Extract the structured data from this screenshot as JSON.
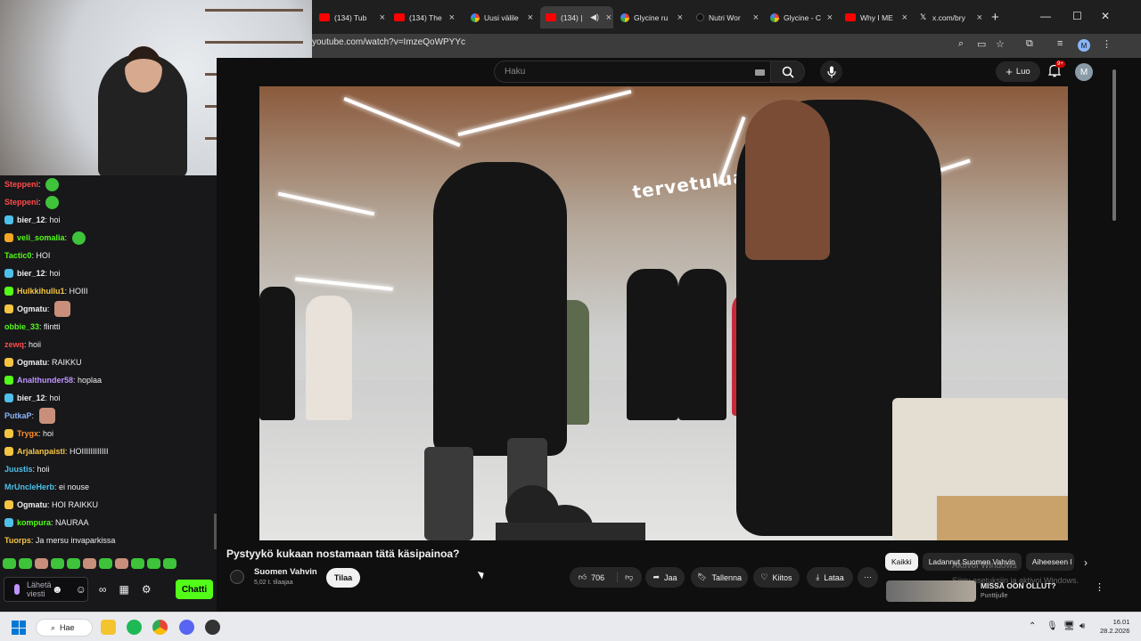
{
  "tabs": [
    {
      "label": "(134) Tub",
      "icon": "youtube"
    },
    {
      "label": "(134) The",
      "icon": "youtube"
    },
    {
      "label": "Uusi välile",
      "icon": "github"
    },
    {
      "label": "(134) |",
      "icon": "youtube",
      "active": true
    },
    {
      "label": "Glycine ru",
      "icon": "google"
    },
    {
      "label": "Nutri Wor",
      "icon": "site"
    },
    {
      "label": "Glycine - C",
      "icon": "google"
    },
    {
      "label": "Why I ME",
      "icon": "youtube"
    },
    {
      "label": "x.com/bry",
      "icon": "x"
    }
  ],
  "address": "youtube.com/watch?v=ImzeQoWPYYc",
  "profile_initial": "M",
  "youtube": {
    "search_placeholder": "Haku",
    "create_label": "Luo",
    "notif_count": "9+",
    "avatar_initial": "M"
  },
  "video": {
    "sign_text": "tervetulua",
    "title": "Pystyykö kukaan nostamaan tätä käsipainoa?",
    "channel": "Suomen Vahvin",
    "subs": "5,02 t. tilaajaa",
    "subscribe_label": "Tilaa",
    "likes": "706",
    "share_label": "Jaa",
    "save_label": "Tallenna",
    "thanks_label": "Kiitos",
    "download_label": "Lataa"
  },
  "chips": [
    "Kaikki",
    "Ladannut Suomen Vahvin",
    "Aiheeseen l"
  ],
  "recommended": {
    "title": "MISSÄ OON OLLUT?",
    "channel": "Punttijulle"
  },
  "activate_windows": [
    "Aktivoi Windows",
    "Siirry asetuksiin ja aktivoi Windows."
  ],
  "chat": {
    "messages": [
      {
        "user": "Steppeni",
        "color": "#ff4a4a",
        "text": "",
        "emote": true,
        "badge": ""
      },
      {
        "user": "Steppeni",
        "color": "#ff4a4a",
        "text": "",
        "emote": true,
        "badge": ""
      },
      {
        "user": "bier_12",
        "color": "#efeff1",
        "text": "hoi",
        "emote": false,
        "badge": "#4ec0e9"
      },
      {
        "user": "veli_somalia",
        "color": "#53fc18",
        "text": "",
        "emote": true,
        "badge": "#f5a623"
      },
      {
        "user": "Tactic0",
        "color": "#53fc18",
        "text": "HOI",
        "emote": false,
        "badge": ""
      },
      {
        "user": "bier_12",
        "color": "#efeff1",
        "text": "hoi",
        "emote": false,
        "badge": "#4ec0e9"
      },
      {
        "user": "Hulkkihullu1",
        "color": "#f5c542",
        "text": "HOIII",
        "emote": false,
        "badge": "#53fc18"
      },
      {
        "user": "Ogmatu",
        "color": "#efeff1",
        "text": "",
        "emote": true,
        "face": true,
        "badge": "#f5c542"
      },
      {
        "user": "obbie_33",
        "color": "#53fc18",
        "text": "flintti",
        "emote": false,
        "badge": ""
      },
      {
        "user": "zewq",
        "color": "#ff4a4a",
        "text": "hoii",
        "emote": false,
        "badge": ""
      },
      {
        "user": "Ogmatu",
        "color": "#efeff1",
        "text": "RAIKKU",
        "emote": false,
        "badge": "#f5c542"
      },
      {
        "user": "Analthunder58",
        "color": "#bf94ff",
        "text": "hoplaa",
        "emote": false,
        "badge": "#53fc18"
      },
      {
        "user": "bier_12",
        "color": "#efeff1",
        "text": "hoi",
        "emote": false,
        "badge": "#4ec0e9"
      },
      {
        "user": "PutkaP",
        "color": "#8ab4f8",
        "text": "",
        "emote": true,
        "face": true,
        "badge": ""
      },
      {
        "user": "Trygx",
        "color": "#ff8c2a",
        "text": "hoi",
        "emote": false,
        "badge": "#f5c542"
      },
      {
        "user": "Arjalanpaisti",
        "color": "#f5c542",
        "text": "HOIIIIIIIIIIII",
        "emote": false,
        "badge": "#f5c542"
      },
      {
        "user": "Juustis",
        "color": "#4ec0e9",
        "text": "hoii",
        "emote": false,
        "badge": ""
      },
      {
        "user": "MrUncleHerb",
        "color": "#4ec0e9",
        "text": "ei nouse",
        "emote": false,
        "badge": ""
      },
      {
        "user": "Ogmatu",
        "color": "#efeff1",
        "text": "HOI RAIKKU",
        "emote": false,
        "badge": "#f5c542"
      },
      {
        "user": "kompura",
        "color": "#53fc18",
        "text": "NAURAA",
        "emote": false,
        "badge": "#4ec0e9"
      },
      {
        "user": "Tuorps",
        "color": "#f5c542",
        "text": "Ja mersu invaparkissa",
        "emote": false,
        "badge": ""
      }
    ],
    "input_placeholder": "Lähetä viesti",
    "send_label": "Chatti"
  },
  "taskbar": {
    "search_label": "Hae",
    "time": "16.01",
    "date": "28.2.2026"
  }
}
